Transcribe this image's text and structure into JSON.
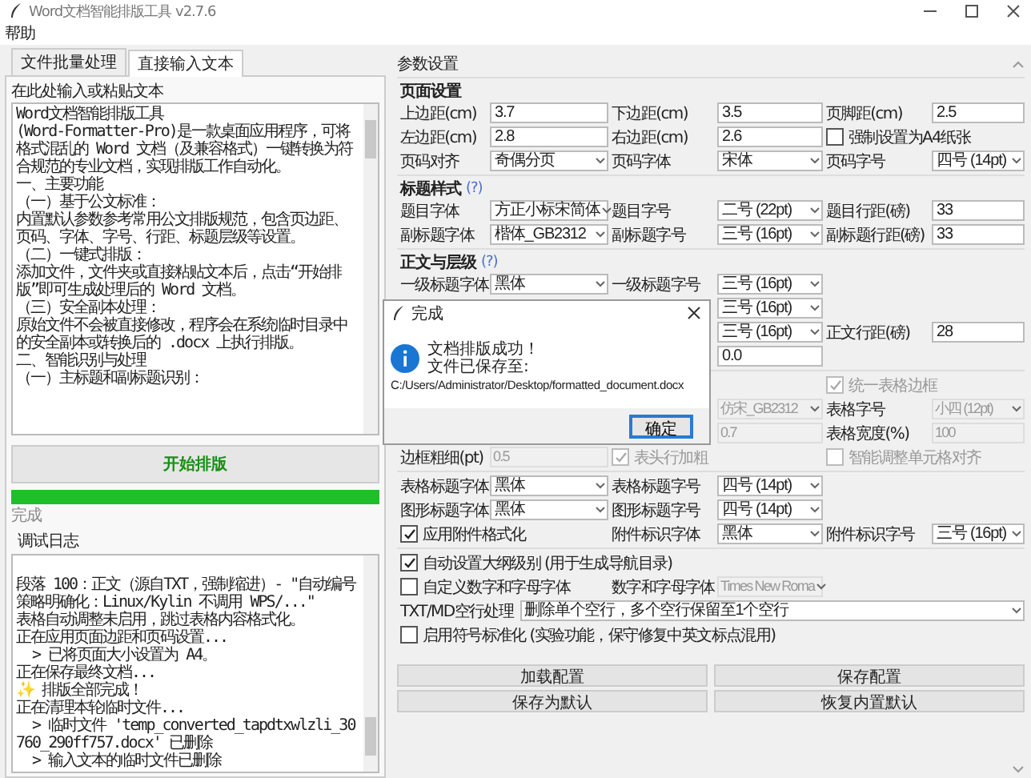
{
  "window": {
    "title": "Word文档智能排版工具 v2.7.6"
  },
  "menu": [
    "帮助"
  ],
  "left": {
    "tabs": [
      {
        "label": "文件批量处理",
        "selected": false
      },
      {
        "label": "直接输入文本",
        "selected": true
      }
    ],
    "input_label": "在此处输入或粘贴文本",
    "input_paragraphs": [
      "Word文档智能排版工具",
      "(Word-Formatter-Pro)是一款桌面应用程序，可将格式混乱的 Word 文档（及兼容格式）一键转换为符合规范的专业文档，实现排版工作自动化。",
      "一、主要功能",
      "（一）基于公文标准：",
      "内置默认参数参考常用公文排版规范，包含页边距、页码、字体、字号、行距、标题层级等设置。",
      "（二）一键式排版：",
      "添加文件，文件夹或直接粘贴文本后，点击“开始排版”即可生成处理后的 Word 文档。",
      "（三）安全副本处理：",
      "原始文件不会被直接修改，程序会在系统临时目录中的安全副本或转换后的 .docx 上执行排版。",
      "二、智能识别与处理",
      "（一）主标题和副标题识别："
    ],
    "start_button": "开始排版",
    "progress": {
      "level": 1
    },
    "status": "完成",
    "log_label": "调试日志",
    "log_lines": [
      "段落 100：正文（源自TXT，强制缩进）- \"自动编号策略明确化：Linux/Kylin 不调用 WPS/...\"",
      "表格自动调整未启用，跳过表格内容格式化。",
      "正在应用页面边距和页码设置...",
      "  > 已将页面大小设置为 A4。",
      "正在保存最终文档...",
      "✨ 排版全部完成！",
      "正在清理本轮临时文件...",
      "  > 临时文件 'temp_converted_tapdtxwlzli_30760_290ff757.docx' 已删除",
      "  > 输入文本的临时文件已删除"
    ]
  },
  "settings": {
    "title": "参数设置",
    "sections": [
      {
        "title": "页面设置",
        "rows": [
          [
            {
              "kind": "input",
              "label": "上边距(cm)",
              "value": "3.7"
            },
            {
              "kind": "input",
              "label": "下边距(cm)",
              "value": "3.5"
            },
            {
              "kind": "input",
              "label": "页脚距(cm)",
              "value": "2.5"
            }
          ],
          [
            {
              "kind": "input",
              "label": "左边距(cm)",
              "value": "2.8"
            },
            {
              "kind": "input",
              "label": "右边距(cm)",
              "value": "2.6"
            },
            {
              "kind": "checkbox",
              "label": "强制设置为A4纸张",
              "checked": false
            }
          ],
          [
            {
              "kind": "select",
              "label": "页码对齐",
              "value": "奇偶分页"
            },
            {
              "kind": "select",
              "label": "页码字体",
              "value": "宋体"
            },
            {
              "kind": "select",
              "label": "页码字号",
              "value": "四号 (14pt)"
            }
          ]
        ]
      },
      {
        "title": "标题样式",
        "help": "(?)",
        "rows": [
          [
            {
              "kind": "select",
              "label": "题目字体",
              "value": "方正小标宋简体"
            },
            {
              "kind": "select",
              "label": "题目字号",
              "value": "二号 (22pt)"
            },
            {
              "kind": "input",
              "label": "题目行距(磅)",
              "value": "33"
            }
          ],
          [
            {
              "kind": "select",
              "label": "副标题字体",
              "value": "楷体_GB2312"
            },
            {
              "kind": "select",
              "label": "副标题字号",
              "value": "三号 (16pt)"
            },
            {
              "kind": "input",
              "label": "副标题行距(磅)",
              "value": "33"
            }
          ]
        ]
      },
      {
        "title": "正文与层级",
        "help": "(?)",
        "rows": [
          [
            {
              "kind": "select",
              "label": "一级标题字体",
              "value": "黑体"
            },
            {
              "kind": "select",
              "label": "一级标题字号",
              "value": "三号 (16pt)"
            }
          ],
          [
            "",
            {
              "kind": "select",
              "value": "三号 (16pt)"
            }
          ],
          [
            "",
            {
              "kind": "select",
              "value": "三号 (16pt)"
            },
            {
              "kind": "input",
              "label": "正文行距(磅)",
              "value": "28"
            }
          ],
          [
            "",
            {
              "kind": "input",
              "value": "0.0"
            }
          ]
        ]
      },
      {
        "rows": [
          [
            "",
            "",
            {
              "kind": "checkbox",
              "label": "统一表格边框",
              "checked": true,
              "disabled": true
            }
          ],
          [
            "",
            {
              "kind": "select",
              "value": "仿宋_GB2312",
              "disabled": true
            },
            {
              "kind": "select",
              "label": "表格字号",
              "value": "小四 (12pt)",
              "disabled": true
            }
          ],
          [
            "",
            {
              "kind": "input",
              "value": "0.7",
              "disabled": true
            },
            {
              "kind": "input",
              "label": "表格宽度(%)",
              "value": "100",
              "disabled": true
            }
          ],
          [
            {
              "kind": "input",
              "label": "边框粗细(pt)",
              "value": "0.5",
              "disabled": true
            },
            {
              "kind": "checkbox",
              "label": "表头行加粗",
              "checked": true,
              "disabled": true
            },
            {
              "kind": "checkbox",
              "label": "智能调整单元格对齐",
              "checked": false,
              "disabled": true
            }
          ]
        ]
      },
      {
        "rows": [
          [
            {
              "kind": "select",
              "label": "表格标题字体",
              "value": "黑体"
            },
            {
              "kind": "select",
              "label": "表格标题字号",
              "value": "四号 (14pt)"
            }
          ],
          [
            {
              "kind": "select",
              "label": "图形标题字体",
              "value": "黑体"
            },
            {
              "kind": "select",
              "label": "图形标题字号",
              "value": "四号 (14pt)"
            }
          ],
          [
            {
              "kind": "checkbox",
              "label": "应用附件格式化",
              "checked": true
            },
            {
              "kind": "select",
              "label": "附件标识字体",
              "value": "黑体"
            },
            {
              "kind": "select",
              "label": "附件标识字号",
              "value": "三号 (16pt)"
            }
          ]
        ]
      },
      {
        "rows": [
          [
            {
              "kind": "checkbox",
              "label": "自动设置大纲级别 (用于生成导航目录)",
              "checked": true
            }
          ],
          [
            {
              "kind": "checkbox",
              "label": "自定义数字和字母字体",
              "checked": false
            },
            {
              "kind": "select",
              "label": "数字和字母字体",
              "value": "Times New Roma",
              "disabled": true
            }
          ],
          [
            {
              "kind": "wide_select",
              "label": "TXT/MD空行处理",
              "value": "删除单个空行，多个空行保留至1个空行"
            }
          ],
          [
            {
              "kind": "checkbox",
              "label": "启用符号标准化 (实验功能，保守修复中英文标点混用)",
              "checked": false
            }
          ]
        ]
      }
    ],
    "buttons": [
      "加载配置",
      "保存配置",
      "保存为默认",
      "恢复内置默认"
    ]
  },
  "dialog": {
    "title": "完成",
    "lines": [
      "文档排版成功！",
      "文件已保存至:"
    ],
    "path": "C:/Users/Administrator/Desktop/formatted_document.docx",
    "button": "确定"
  }
}
